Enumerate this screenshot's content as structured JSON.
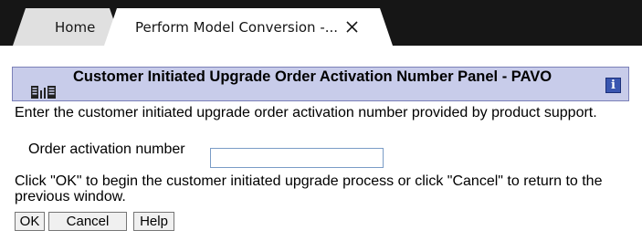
{
  "tabs": [
    {
      "label": "Home",
      "active": false
    },
    {
      "label": "Perform Model Conversion -...",
      "active": true
    }
  ],
  "icons": {
    "tab_close": "close-icon",
    "panel_header": "hardware-system-icon",
    "info": "info-icon"
  },
  "info_icon_glyph": "i",
  "panel": {
    "title": "Customer Initiated Upgrade Order Activation Number Panel - PAVO",
    "description": "Enter the customer initiated upgrade order activation number provided by product support.",
    "order_label": "Order activation number",
    "order_value": "",
    "instruction": "Click \"OK\" to begin the customer initiated upgrade process or click \"Cancel\" to return to the previous window."
  },
  "buttons": {
    "ok": "OK",
    "cancel": "Cancel",
    "help": "Help"
  },
  "colors": {
    "tab_bar": "#161616",
    "header_bg": "#c8ccea",
    "info_icon_bg": "#3a56b0"
  }
}
